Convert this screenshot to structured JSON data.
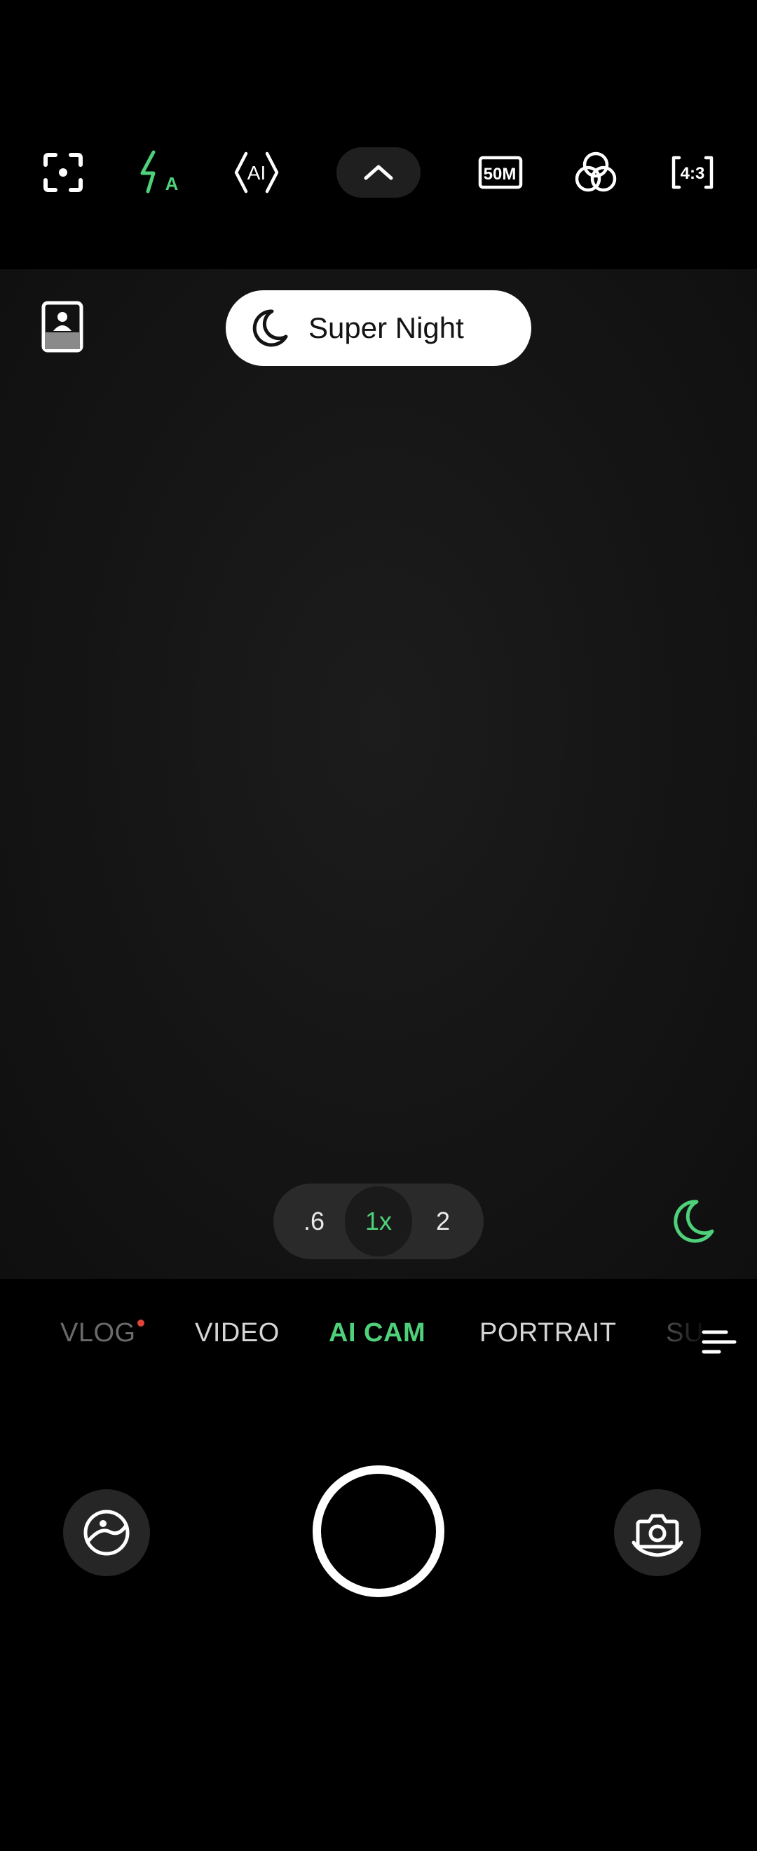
{
  "toolbar": {
    "icons": [
      {
        "name": "focus-scan-icon"
      },
      {
        "name": "flash-auto-icon",
        "label": "A"
      },
      {
        "name": "ai-scene-icon",
        "label": "AI"
      },
      {
        "name": "collapse-chevron-icon"
      },
      {
        "name": "resolution-icon",
        "label": "50M"
      },
      {
        "name": "filters-icon"
      },
      {
        "name": "aspect-ratio-icon",
        "label": "4:3"
      }
    ],
    "accent_color": "#4ed17a"
  },
  "viewfinder": {
    "mode_chip": {
      "label": "Super Night",
      "icon": "moon-icon"
    },
    "portrait_badge_icon": "portrait-badge-icon",
    "zoom": {
      "options": [
        ".6",
        "1x",
        "2"
      ],
      "selected": "1x"
    },
    "night_toggle_icon": "moon-icon"
  },
  "modes": {
    "tabs": [
      "VLOG",
      "VIDEO",
      "AI CAM",
      "PORTRAIT",
      "SU"
    ],
    "active": "AI CAM",
    "new_indicator_on": "VLOG",
    "more_icon": "menu-lines-icon"
  },
  "controls": {
    "gallery_icon": "gallery-icon",
    "shutter": "shutter-button",
    "flip_icon": "flip-camera-icon"
  }
}
